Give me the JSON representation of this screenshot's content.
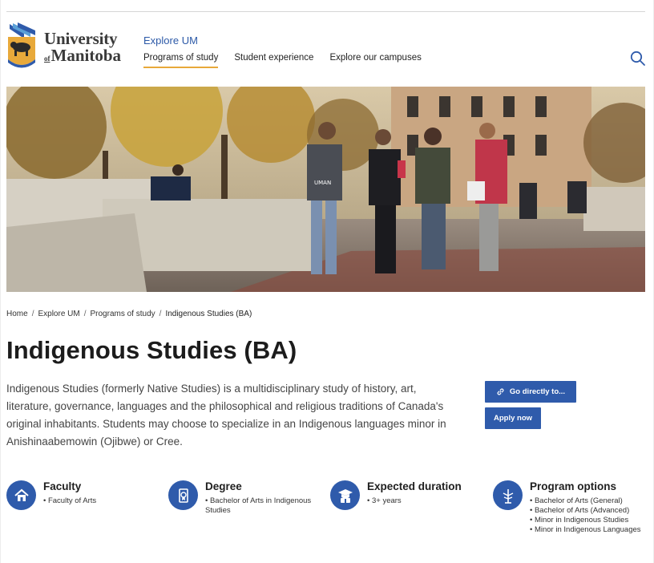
{
  "brand": {
    "line1": "University",
    "line2_prefix": "of",
    "line2": "Manitoba"
  },
  "header": {
    "explore_label": "Explore UM",
    "nav": [
      {
        "label": "Programs of study",
        "active": true
      },
      {
        "label": "Student experience",
        "active": false
      },
      {
        "label": "Explore our campuses",
        "active": false
      }
    ],
    "search_icon": "search-icon"
  },
  "hero": {
    "shirt_text": "UMAN"
  },
  "breadcrumb": {
    "items": [
      "Home",
      "Explore UM",
      "Programs of study",
      "Indigenous Studies (BA)"
    ],
    "separator": "/"
  },
  "page": {
    "title": "Indigenous Studies (BA)",
    "intro": "Indigenous Studies (formerly Native Studies) is a multidisciplinary study of history, art, literature, governance, languages and the philosophical and religious traditions of Canada's original inhabitants. Students may choose to specialize in an Indigenous languages minor in Anishinaabemowin (Ojibwe) or Cree."
  },
  "actions": {
    "go_directly_label": "Go directly to...",
    "apply_label": "Apply now"
  },
  "facts": {
    "faculty": {
      "title": "Faculty",
      "items": [
        "Faculty of Arts"
      ],
      "icon": "home-icon"
    },
    "degree": {
      "title": "Degree",
      "items": [
        "Bachelor of Arts in Indigenous Studies"
      ],
      "icon": "diploma-icon"
    },
    "duration": {
      "title": "Expected duration",
      "items": [
        "3+ years"
      ],
      "icon": "graduate-icon"
    },
    "options": {
      "title": "Program options",
      "items": [
        "Bachelor of Arts (General)",
        "Bachelor of Arts (Advanced)",
        "Minor in Indigenous Studies",
        "Minor in Indigenous Languages"
      ],
      "icon": "signpost-icon"
    }
  },
  "colors": {
    "primary_blue": "#2f5bab",
    "nav_active_underline": "#e8a93a",
    "link_blue": "#2d5aa8"
  }
}
